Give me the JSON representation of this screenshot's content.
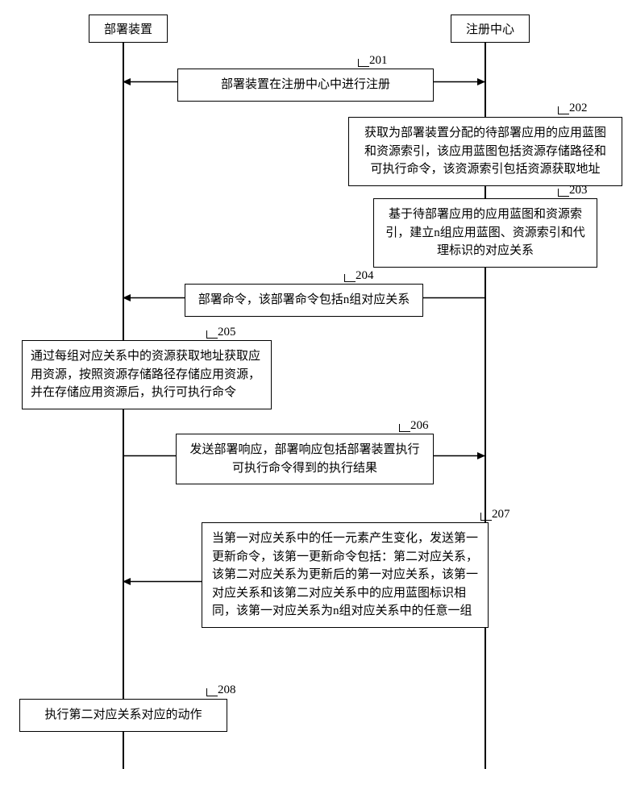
{
  "actors": {
    "left": "部署装置",
    "right": "注册中心"
  },
  "steps": {
    "s201": {
      "num": "201",
      "text": "部署装置在注册中心中进行注册"
    },
    "s202": {
      "num": "202",
      "text": "获取为部署装置分配的待部署应用的应用蓝图和资源索引，该应用蓝图包括资源存储路径和可执行命令，该资源索引包括资源获取地址"
    },
    "s203": {
      "num": "203",
      "text": "基于待部署应用的应用蓝图和资源索引，建立n组应用蓝图、资源索引和代理标识的对应关系"
    },
    "s204": {
      "num": "204",
      "text": "部署命令，该部署命令包括n组对应关系"
    },
    "s205": {
      "num": "205",
      "text": "通过每组对应关系中的资源获取地址获取应用资源，按照资源存储路径存储应用资源，并在存储应用资源后，执行可执行命令"
    },
    "s206": {
      "num": "206",
      "text": "发送部署响应，部署响应包括部署装置执行可执行命令得到的执行结果"
    },
    "s207": {
      "num": "207",
      "text": "当第一对应关系中的任一元素产生变化，发送第一更新命令，该第一更新命令包括：第二对应关系，该第二对应关系为更新后的第一对应关系，该第一对应关系和该第二对应关系中的应用蓝图标识相同，该第一对应关系为n组对应关系中的任意一组"
    },
    "s208": {
      "num": "208",
      "text": "执行第二对应关系对应的动作"
    }
  },
  "chart_data": {
    "type": "table",
    "description": "UML sequence diagram",
    "actors": [
      "部署装置",
      "注册中心"
    ],
    "messages": [
      {
        "step": 201,
        "from": "部署装置",
        "to": "注册中心",
        "direction": "bidirectional",
        "label": "部署装置在注册中心中进行注册"
      },
      {
        "step": 202,
        "from": "注册中心",
        "to": "注册中心",
        "direction": "self",
        "label": "获取为部署装置分配的待部署应用的应用蓝图和资源索引，该应用蓝图包括资源存储路径和可执行命令，该资源索引包括资源获取地址"
      },
      {
        "step": 203,
        "from": "注册中心",
        "to": "注册中心",
        "direction": "self",
        "label": "基于待部署应用的应用蓝图和资源索引，建立n组应用蓝图、资源索引和代理标识的对应关系"
      },
      {
        "step": 204,
        "from": "注册中心",
        "to": "部署装置",
        "direction": "left",
        "label": "部署命令，该部署命令包括n组对应关系"
      },
      {
        "step": 205,
        "from": "部署装置",
        "to": "部署装置",
        "direction": "self",
        "label": "通过每组对应关系中的资源获取地址获取应用资源，按照资源存储路径存储应用资源，并在存储应用资源后，执行可执行命令"
      },
      {
        "step": 206,
        "from": "部署装置",
        "to": "注册中心",
        "direction": "right",
        "label": "发送部署响应，部署响应包括部署装置执行可执行命令得到的执行结果"
      },
      {
        "step": 207,
        "from": "注册中心",
        "to": "部署装置",
        "direction": "left",
        "label": "当第一对应关系中的任一元素产生变化，发送第一更新命令，该第一更新命令包括：第二对应关系，该第二对应关系为更新后的第一对应关系，该第一对应关系和该第二对应关系中的应用蓝图标识相同，该第一对应关系为n组对应关系中的任意一组"
      },
      {
        "step": 208,
        "from": "部署装置",
        "to": "部署装置",
        "direction": "self",
        "label": "执行第二对应关系对应的动作"
      }
    ]
  }
}
